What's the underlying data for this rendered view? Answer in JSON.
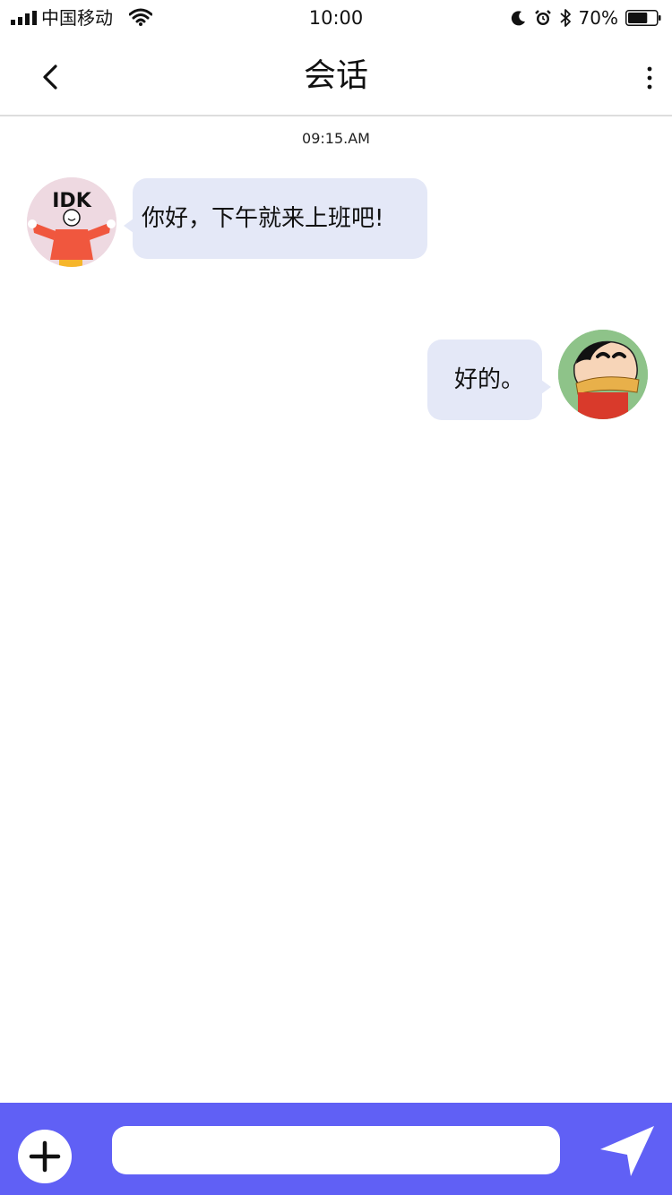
{
  "status_bar": {
    "carrier": "中国移动",
    "time": "10:00",
    "battery_percent": "70%",
    "battery_level": 0.7,
    "icons": [
      "signal-icon",
      "wifi-icon",
      "moon-icon",
      "alarm-icon",
      "bluetooth-icon",
      "battery-icon"
    ]
  },
  "nav": {
    "title": "会话",
    "back_icon": "chevron-left-icon",
    "more_icon": "more-vertical-icon"
  },
  "chat": {
    "timestamp": "09:15.AM",
    "messages": [
      {
        "side": "received",
        "text": "你好，下午就来上班吧!"
      },
      {
        "side": "sent",
        "text": "好的。"
      }
    ],
    "avatar_left_text": "IDK",
    "bubble_color": "#e4e8f7"
  },
  "input_bar": {
    "value": "",
    "placeholder": "",
    "add_icon": "plus-icon",
    "send_icon": "send-icon",
    "color": "#6060f5"
  }
}
